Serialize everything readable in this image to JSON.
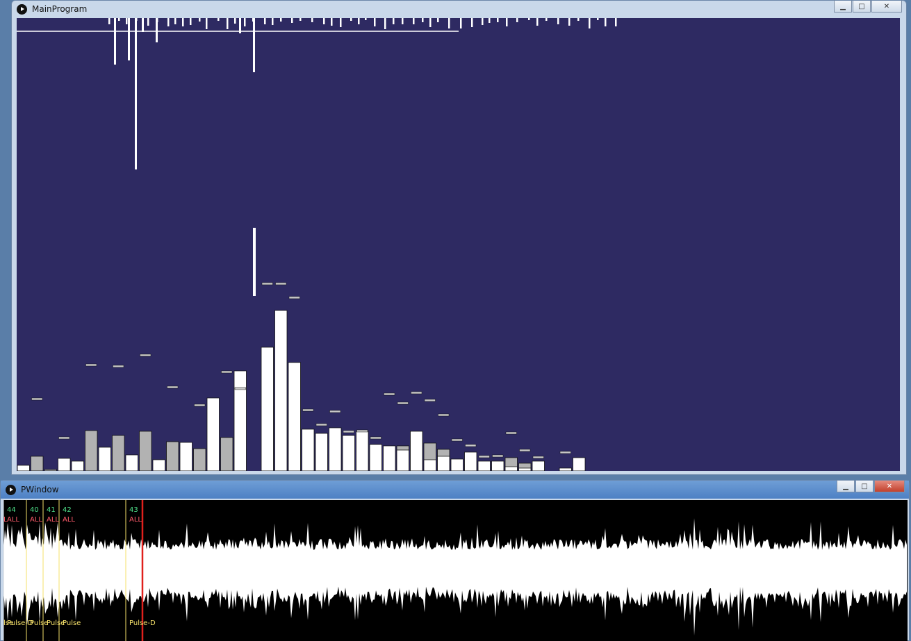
{
  "main_window": {
    "title": "MainProgram",
    "minimize_glyph": "▁",
    "maximize_glyph": "□",
    "close_glyph": "✕",
    "canvas_background": "#2e2a62",
    "spectrum_bands": [
      {
        "white": 8,
        "gray": 0,
        "peak": 0
      },
      {
        "white": 0,
        "gray": 21,
        "peak": 103
      },
      {
        "white": 0,
        "gray": 2,
        "peak": 0
      },
      {
        "white": 18,
        "gray": 13,
        "peak": 47
      },
      {
        "white": 14,
        "gray": 0,
        "peak": 0
      },
      {
        "white": 0,
        "gray": 58,
        "peak": 152
      },
      {
        "white": 34,
        "gray": 0,
        "peak": 0
      },
      {
        "white": 0,
        "gray": 51,
        "peak": 150
      },
      {
        "white": 23,
        "gray": 0,
        "peak": 0
      },
      {
        "white": 0,
        "gray": 57,
        "peak": 166
      },
      {
        "white": 16,
        "gray": 0,
        "peak": 0
      },
      {
        "white": 0,
        "gray": 42,
        "peak": 120
      },
      {
        "white": 41,
        "gray": 0,
        "peak": 0
      },
      {
        "white": 0,
        "gray": 32,
        "peak": 94
      },
      {
        "white": 105,
        "gray": 0,
        "peak": 0
      },
      {
        "white": 0,
        "gray": 48,
        "peak": 142
      },
      {
        "white": 144,
        "gray": 32,
        "peak": 118
      },
      {
        "white": 0,
        "gray": 0,
        "peak": 0
      },
      {
        "white": 178,
        "gray": 93,
        "peak": 269
      },
      {
        "white": 231,
        "gray": 71,
        "peak": 269
      },
      {
        "white": 156,
        "gray": 88,
        "peak": 249
      },
      {
        "white": 60,
        "gray": 32,
        "peak": 87
      },
      {
        "white": 54,
        "gray": 24,
        "peak": 66
      },
      {
        "white": 62,
        "gray": 24,
        "peak": 85
      },
      {
        "white": 51,
        "gray": 15,
        "peak": 56
      },
      {
        "white": 57,
        "gray": 16,
        "peak": 57
      },
      {
        "white": 38,
        "gray": 16,
        "peak": 47
      },
      {
        "white": 36,
        "gray": 0,
        "peak": 110
      },
      {
        "white": 30,
        "gray": 36,
        "peak": 97
      },
      {
        "white": 57,
        "gray": 43,
        "peak": 112
      },
      {
        "white": 16,
        "gray": 40,
        "peak": 101
      },
      {
        "white": 21,
        "gray": 31,
        "peak": 80
      },
      {
        "white": 17,
        "gray": 16,
        "peak": 44
      },
      {
        "white": 27,
        "gray": 10,
        "peak": 36
      },
      {
        "white": 14,
        "gray": 6,
        "peak": 20
      },
      {
        "white": 14,
        "gray": 6,
        "peak": 21
      },
      {
        "white": 6,
        "gray": 19,
        "peak": 54
      },
      {
        "white": 4,
        "gray": 11,
        "peak": 29
      },
      {
        "white": 14,
        "gray": 6,
        "peak": 19
      },
      {
        "white": 0,
        "gray": 0,
        "peak": 0
      },
      {
        "white": 4,
        "gray": 0,
        "peak": 26
      },
      {
        "white": 19,
        "gray": 0,
        "peak": 0
      }
    ]
  },
  "p_window": {
    "title": "PWindow",
    "minimize_glyph": "▁",
    "maximize_glyph": "□",
    "close_glyph": "✕",
    "markers": [
      {
        "number": "",
        "label": "L",
        "pulse": "lse"
      },
      {
        "number": "40",
        "label": "ALL",
        "pulse": "Pulse"
      },
      {
        "number": "41",
        "label": "ALL",
        "pulse": "Pulse"
      },
      {
        "number": "42",
        "label": "ALL",
        "pulse": "Pulse"
      },
      {
        "number": "43",
        "label": "ALL",
        "pulse": "Pulse-D"
      },
      {
        "number": "44",
        "label": "ALL",
        "pulse": "Pulse-D"
      }
    ],
    "number_color": "#4fe08a",
    "label_color": "#ff5b6b",
    "pulse_color": "#f5e06a",
    "playhead_color": "#e0201c"
  }
}
